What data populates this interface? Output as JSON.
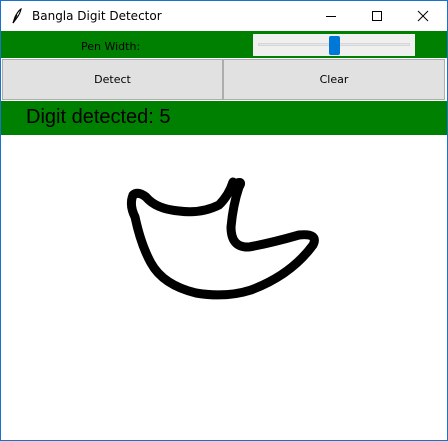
{
  "window": {
    "title": "Bangla Digit Detector",
    "app_icon": "feather-icon",
    "controls": [
      "minimize-icon",
      "maximize-icon",
      "close-icon"
    ]
  },
  "pen": {
    "label": "Pen Width:",
    "slider_value_fraction": 0.5
  },
  "buttons": {
    "detect": "Detect",
    "clear": "Clear"
  },
  "result": {
    "text": "Digit detected: 5"
  },
  "colors": {
    "accent_green": "#008000",
    "slider_thumb": "#0078d7",
    "stroke": "#000000"
  }
}
